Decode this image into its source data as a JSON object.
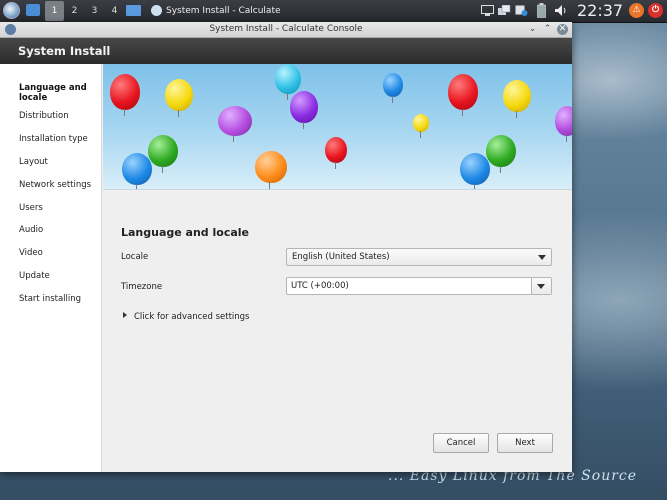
{
  "panel": {
    "workspaces": [
      "1",
      "2",
      "3",
      "4"
    ],
    "active_workspace": "1",
    "task_title": "System Install - Calculate Console",
    "clock": "22:37",
    "icons": [
      "app-menu-icon",
      "file-manager-icon",
      "show-desktop-icon",
      "display-icon",
      "network-icon",
      "clipboard-icon",
      "battery-icon",
      "volume-icon",
      "update-notifier-icon",
      "power-icon"
    ]
  },
  "window": {
    "title": "System Install - Calculate Console",
    "header_title": "System Install"
  },
  "sidebar": {
    "items": [
      {
        "label": "Language and locale",
        "active": true
      },
      {
        "label": "Distribution",
        "active": false
      },
      {
        "label": "Installation type",
        "active": false
      },
      {
        "label": "Layout",
        "active": false
      },
      {
        "label": "Network settings",
        "active": false
      },
      {
        "label": "Users",
        "active": false
      },
      {
        "label": "Audio",
        "active": false
      },
      {
        "label": "Video",
        "active": false
      },
      {
        "label": "Update",
        "active": false
      },
      {
        "label": "Start installing",
        "active": false
      }
    ]
  },
  "main": {
    "section_title": "Language and locale",
    "locale_label": "Locale",
    "locale_value": "English (United States)",
    "timezone_label": "Timezone",
    "timezone_value": "UTC (+00:00)",
    "advanced_label": "Click for advanced settings",
    "cancel_label": "Cancel",
    "next_label": "Next"
  },
  "desktop": {
    "slogan": "... Easy Linux from The Source"
  },
  "colors": {
    "header_bg": "#333333",
    "banner_sky": "#8fcbee",
    "balloons": [
      "#e8141f",
      "#f5d90e",
      "#2fc1e6",
      "#8a2be2",
      "#1e88e5",
      "#2eaa22",
      "#ff8c1a",
      "#b54ee0"
    ]
  }
}
